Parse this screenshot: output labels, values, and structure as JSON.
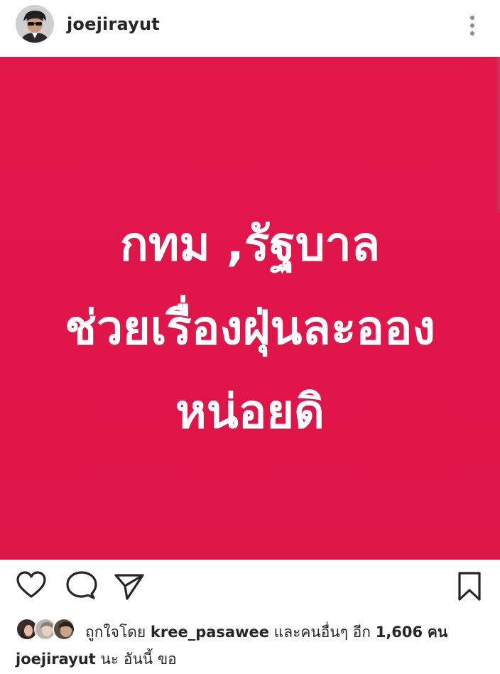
{
  "post_header": {
    "username": "joejirayut",
    "avatar_icon": "profile-photo",
    "more_icon": "vertical-dots-icon"
  },
  "post_image": {
    "background_color": "#e0154a",
    "text_color": "#ffffff",
    "lines": [
      "กทม ,รัฐบาล",
      "ช่วยเรื่องฝุ่นละออง",
      "หน่อยดิ"
    ]
  },
  "actions": {
    "like_icon": "heart-outline-icon",
    "comment_icon": "speech-bubble-icon",
    "share_icon": "paper-plane-icon",
    "save_icon": "bookmark-icon"
  },
  "likes": {
    "prefix": "ถูกใจโดย",
    "user": "kree_pasawee",
    "middle": "และคนอื่นๆ อีก",
    "count": "1,606",
    "suffix": "คน"
  },
  "caption": {
    "username": "joejirayut",
    "text": "นะ อันนี้ ขอ"
  }
}
